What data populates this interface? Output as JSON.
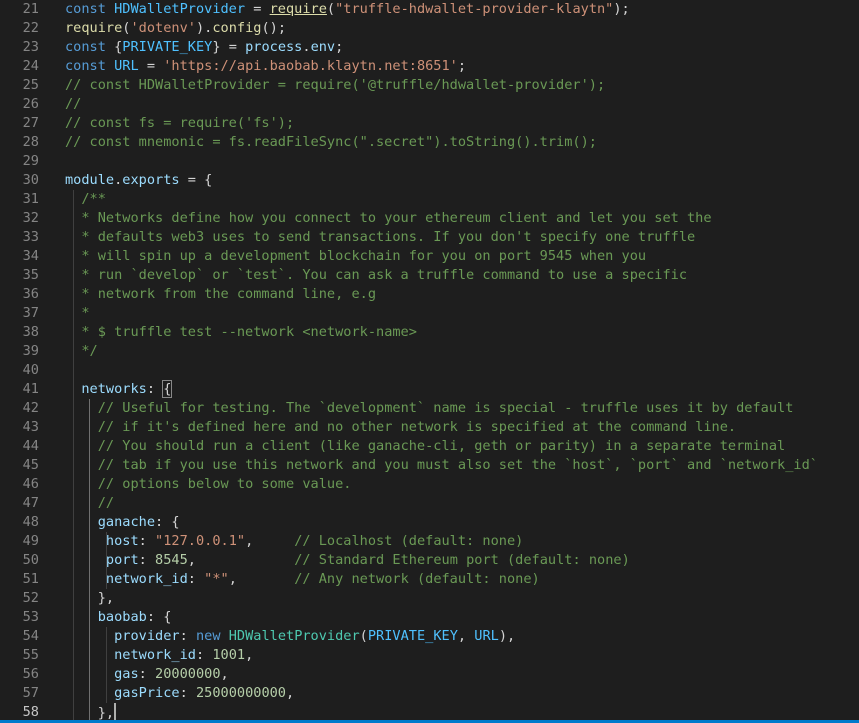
{
  "editor": {
    "theme": {
      "background": "#1e1e1e",
      "keyword": "#569cd6",
      "string": "#ce9178",
      "comment": "#6a9955",
      "variable": "#9cdcfe",
      "number": "#b5cea8",
      "function": "#dcdcaa"
    },
    "current_line": 58,
    "lines": [
      {
        "n": "21",
        "tokens": [
          [
            "kw",
            "const "
          ],
          [
            "ct",
            "HDWalletProvider"
          ],
          [
            "pl",
            " = "
          ],
          [
            "fn ul",
            "require"
          ],
          [
            "pl",
            "("
          ],
          [
            "str",
            "\"truffle-hdwallet-provider-klaytn\""
          ],
          [
            "pl",
            ");"
          ]
        ]
      },
      {
        "n": "22",
        "tokens": [
          [
            "fn",
            "require"
          ],
          [
            "pl",
            "("
          ],
          [
            "str",
            "'dotenv'"
          ],
          [
            "pl",
            ")."
          ],
          [
            "fn",
            "config"
          ],
          [
            "pl",
            "();"
          ]
        ]
      },
      {
        "n": "23",
        "tokens": [
          [
            "kw",
            "const "
          ],
          [
            "pl",
            "{"
          ],
          [
            "ct",
            "PRIVATE_KEY"
          ],
          [
            "pl",
            "} = "
          ],
          [
            "var",
            "process"
          ],
          [
            "pl",
            "."
          ],
          [
            "var",
            "env"
          ],
          [
            "pl",
            ";"
          ]
        ]
      },
      {
        "n": "24",
        "tokens": [
          [
            "kw",
            "const "
          ],
          [
            "ct",
            "URL"
          ],
          [
            "pl",
            " = "
          ],
          [
            "str",
            "'https://api.baobab.klaytn.net:8651'"
          ],
          [
            "pl",
            ";"
          ]
        ]
      },
      {
        "n": "25",
        "tokens": [
          [
            "cm",
            "// const HDWalletProvider = require('@truffle/hdwallet-provider');"
          ]
        ]
      },
      {
        "n": "26",
        "tokens": [
          [
            "cm",
            "//"
          ]
        ]
      },
      {
        "n": "27",
        "tokens": [
          [
            "cm",
            "// const fs = require('fs');"
          ]
        ]
      },
      {
        "n": "28",
        "tokens": [
          [
            "cm",
            "// const mnemonic = fs.readFileSync(\".secret\").toString().trim();"
          ]
        ]
      },
      {
        "n": "29",
        "tokens": []
      },
      {
        "n": "30",
        "tokens": [
          [
            "var",
            "module"
          ],
          [
            "pl",
            "."
          ],
          [
            "var",
            "exports"
          ],
          [
            "pl",
            " = {"
          ]
        ]
      },
      {
        "n": "31",
        "tokens": [
          [
            "pl",
            "  "
          ],
          [
            "cm",
            "/**"
          ]
        ]
      },
      {
        "n": "32",
        "tokens": [
          [
            "pl",
            "  "
          ],
          [
            "cm",
            "* Networks define how you connect to your ethereum client and let you set the"
          ]
        ]
      },
      {
        "n": "33",
        "tokens": [
          [
            "pl",
            "  "
          ],
          [
            "cm",
            "* defaults web3 uses to send transactions. If you don't specify one truffle"
          ]
        ]
      },
      {
        "n": "34",
        "tokens": [
          [
            "pl",
            "  "
          ],
          [
            "cm",
            "* will spin up a development blockchain for you on port 9545 when you"
          ]
        ]
      },
      {
        "n": "35",
        "tokens": [
          [
            "pl",
            "  "
          ],
          [
            "cm",
            "* run `develop` or `test`. You can ask a truffle command to use a specific"
          ]
        ]
      },
      {
        "n": "36",
        "tokens": [
          [
            "pl",
            "  "
          ],
          [
            "cm",
            "* network from the command line, e.g"
          ]
        ]
      },
      {
        "n": "37",
        "tokens": [
          [
            "pl",
            "  "
          ],
          [
            "cm",
            "*"
          ]
        ]
      },
      {
        "n": "38",
        "tokens": [
          [
            "pl",
            "  "
          ],
          [
            "cm",
            "* $ truffle test --network <network-name>"
          ]
        ]
      },
      {
        "n": "39",
        "tokens": [
          [
            "pl",
            "  "
          ],
          [
            "cm",
            "*/"
          ]
        ]
      },
      {
        "n": "40",
        "tokens": []
      },
      {
        "n": "41",
        "tokens": [
          [
            "pl",
            "  "
          ],
          [
            "var",
            "networks"
          ],
          [
            "pl",
            ": "
          ],
          [
            "pl hl",
            "{"
          ]
        ]
      },
      {
        "n": "42",
        "tokens": [
          [
            "pl",
            "    "
          ],
          [
            "cm",
            "// Useful for testing. The `development` name is special - truffle uses it by default"
          ]
        ]
      },
      {
        "n": "43",
        "tokens": [
          [
            "pl",
            "    "
          ],
          [
            "cm",
            "// if it's defined here and no other network is specified at the command line."
          ]
        ]
      },
      {
        "n": "44",
        "tokens": [
          [
            "pl",
            "    "
          ],
          [
            "cm",
            "// You should run a client (like ganache-cli, geth or parity) in a separate terminal"
          ]
        ]
      },
      {
        "n": "45",
        "tokens": [
          [
            "pl",
            "    "
          ],
          [
            "cm",
            "// tab if you use this network and you must also set the `host`, `port` and `network_id`"
          ]
        ]
      },
      {
        "n": "46",
        "tokens": [
          [
            "pl",
            "    "
          ],
          [
            "cm",
            "// options below to some value."
          ]
        ]
      },
      {
        "n": "47",
        "tokens": [
          [
            "pl",
            "    "
          ],
          [
            "cm",
            "//"
          ]
        ]
      },
      {
        "n": "48",
        "tokens": [
          [
            "pl",
            "    "
          ],
          [
            "var",
            "ganache"
          ],
          [
            "pl",
            ": {"
          ]
        ]
      },
      {
        "n": "49",
        "tokens": [
          [
            "pl",
            "     "
          ],
          [
            "var",
            "host"
          ],
          [
            "pl",
            ": "
          ],
          [
            "str",
            "\"127.0.0.1\""
          ],
          [
            "pl",
            ",     "
          ],
          [
            "cm",
            "// Localhost (default: none)"
          ]
        ]
      },
      {
        "n": "50",
        "tokens": [
          [
            "pl",
            "     "
          ],
          [
            "var",
            "port"
          ],
          [
            "pl",
            ": "
          ],
          [
            "num",
            "8545"
          ],
          [
            "pl",
            ",            "
          ],
          [
            "cm",
            "// Standard Ethereum port (default: none)"
          ]
        ]
      },
      {
        "n": "51",
        "tokens": [
          [
            "pl",
            "     "
          ],
          [
            "var",
            "network_id"
          ],
          [
            "pl",
            ": "
          ],
          [
            "str",
            "\"*\""
          ],
          [
            "pl",
            ",       "
          ],
          [
            "cm",
            "// Any network (default: none)"
          ]
        ]
      },
      {
        "n": "52",
        "tokens": [
          [
            "pl",
            "    },"
          ]
        ]
      },
      {
        "n": "53",
        "tokens": [
          [
            "pl",
            "    "
          ],
          [
            "var",
            "baobab"
          ],
          [
            "pl",
            ": {"
          ]
        ]
      },
      {
        "n": "54",
        "tokens": [
          [
            "pl",
            "      "
          ],
          [
            "var",
            "provider"
          ],
          [
            "pl",
            ": "
          ],
          [
            "kw",
            "new "
          ],
          [
            "cls",
            "HDWalletProvider"
          ],
          [
            "pl",
            "("
          ],
          [
            "ct",
            "PRIVATE_KEY"
          ],
          [
            "pl",
            ", "
          ],
          [
            "ct",
            "URL"
          ],
          [
            "pl",
            "),"
          ]
        ]
      },
      {
        "n": "55",
        "tokens": [
          [
            "pl",
            "      "
          ],
          [
            "var",
            "network_id"
          ],
          [
            "pl",
            ": "
          ],
          [
            "num",
            "1001"
          ],
          [
            "pl",
            ","
          ]
        ]
      },
      {
        "n": "56",
        "tokens": [
          [
            "pl",
            "      "
          ],
          [
            "var",
            "gas"
          ],
          [
            "pl",
            ": "
          ],
          [
            "num",
            "20000000"
          ],
          [
            "pl",
            ","
          ]
        ]
      },
      {
        "n": "57",
        "tokens": [
          [
            "pl",
            "      "
          ],
          [
            "var",
            "gasPrice"
          ],
          [
            "pl",
            ": "
          ],
          [
            "num",
            "25000000000"
          ],
          [
            "pl",
            ","
          ]
        ]
      },
      {
        "n": "58",
        "tokens": [
          [
            "pl",
            "    },"
          ]
        ]
      }
    ]
  }
}
